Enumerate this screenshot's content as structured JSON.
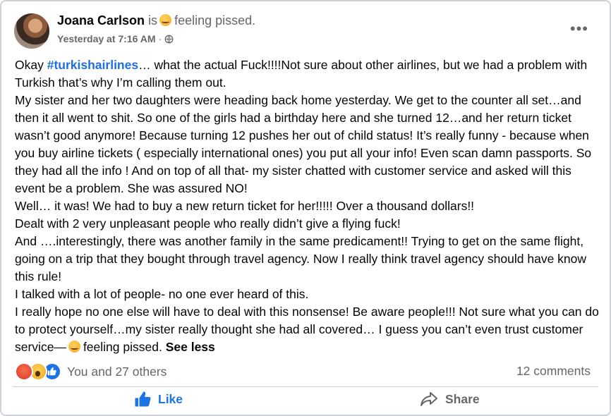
{
  "post": {
    "author": "Joana Carlson",
    "is_text": "is",
    "feeling": "feeling pissed.",
    "time": "Yesterday at 7:16 AM",
    "separator": "·",
    "more_label": "•••",
    "icons": {
      "avatar": "profile-photo",
      "audience": "globe-icon",
      "feeling": "angry-face-icon",
      "more": "more-options-icon"
    },
    "body": {
      "p1_prefix": "Okay ",
      "hashtag": "#turkishairlines",
      "p1_rest": "… what the actual Fuck!!!!Not sure about other airlines, but we had a problem with Turkish that’s why I’m calling them out.",
      "p2": "My sister and her two daughters were heading back home yesterday. We get to the counter all set…and then it all went to shit. So one of the girls had a birthday here and she turned 12…and her return ticket wasn’t good anymore! Because turning 12 pushes her out of child status! It’s really funny - because when you buy airline tickets ( especially international ones) you put all your info! Even scan damn passports. So they had all the info ! And on top of all that- my sister chatted with customer service and asked will this event be a problem. She was assured NO!",
      "p3": "Well… it was! We had to buy a new return ticket for her!!!!! Over a thousand dollars!!",
      "p4": "Dealt with 2 very unpleasant people who really didn’t give a flying fuck!",
      "p5": "And ….interestingly, there was another family in the same predicament!! Trying to get on the same flight, going on a trip that they bought through travel agency. Now I really think travel agency should have know this rule!",
      "p6": "I talked with a lot of people- no one ever heard of this.",
      "p7": "I really hope no one else will have to deal with this nonsense! Be aware people!!!  Not sure what you can do to protect yourself…my sister really thought she had all covered… I guess you can’t even trust customer service—",
      "p7_feeling": "feeling pissed.",
      "see_less": "See less"
    }
  },
  "engagement": {
    "reactions_text": "You and 27 others",
    "reaction_icons": [
      "angry-reaction-icon",
      "wow-reaction-icon",
      "like-reaction-icon"
    ],
    "comments_text": "12 comments"
  },
  "actions": {
    "like_label": "Like",
    "share_label": "Share",
    "like_color": "#1b74e4"
  },
  "colors": {
    "hashtag": "#216fdb",
    "muted": "#65676b",
    "text": "#050505"
  }
}
